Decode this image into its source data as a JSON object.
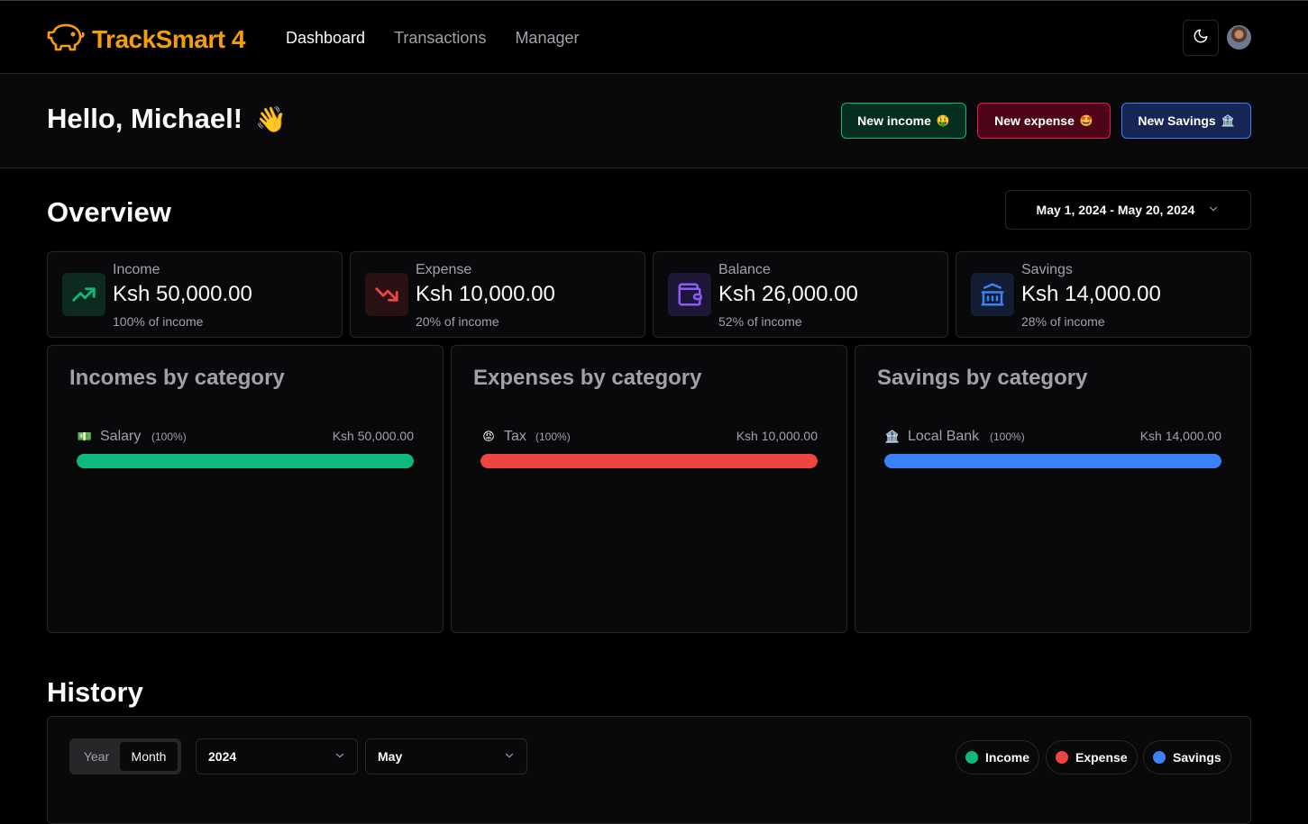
{
  "app": {
    "name": "TrackSmart 4",
    "brand_color": "#f59e0b"
  },
  "nav": {
    "items": [
      {
        "label": "Dashboard",
        "active": true
      },
      {
        "label": "Transactions",
        "active": false
      },
      {
        "label": "Manager",
        "active": false
      }
    ]
  },
  "greeting": {
    "text": "Hello, Michael!",
    "emoji": "👋"
  },
  "actions": {
    "income": {
      "label": "New income",
      "emoji": "🤑",
      "color": "#10b981"
    },
    "expense": {
      "label": "New expense",
      "emoji": "🤩",
      "color": "#e11d48"
    },
    "savings": {
      "label": "New Savings",
      "emoji": "🏦",
      "color": "#3b82f6"
    }
  },
  "overview": {
    "title": "Overview",
    "date_range": "May 1, 2024 - May 20, 2024",
    "stats": [
      {
        "label": "Income",
        "value": "Ksh 50,000.00",
        "sub": "100% of income",
        "icon": "trending-up-icon",
        "color": "#10b981"
      },
      {
        "label": "Expense",
        "value": "Ksh 10,000.00",
        "sub": "20% of income",
        "icon": "trending-down-icon",
        "color": "#ef4444"
      },
      {
        "label": "Balance",
        "value": "Ksh 26,000.00",
        "sub": "52% of income",
        "icon": "wallet-icon",
        "color": "#8b5cf6"
      },
      {
        "label": "Savings",
        "value": "Ksh 14,000.00",
        "sub": "28% of income",
        "icon": "bank-icon",
        "color": "#3b82f6"
      }
    ]
  },
  "categories": [
    {
      "title": "Incomes by category",
      "item": {
        "emoji": "💵",
        "name": "Salary",
        "percent": "(100%)",
        "amount": "Ksh 50,000.00",
        "fill": 1.0
      },
      "color": "#10b981"
    },
    {
      "title": "Expenses by category",
      "item": {
        "emoji": "😡",
        "name": "Tax",
        "percent": "(100%)",
        "amount": "Ksh 10,000.00",
        "fill": 1.0
      },
      "color": "#ef4444"
    },
    {
      "title": "Savings by category",
      "item": {
        "emoji": "🏦",
        "name": "Local Bank",
        "percent": "(100%)",
        "amount": "Ksh 14,000.00",
        "fill": 1.0
      },
      "color": "#3b82f6"
    }
  ],
  "history": {
    "title": "History",
    "tabs": {
      "year": "Year",
      "month": "Month",
      "selected": "Month"
    },
    "year_select": "2024",
    "month_select": "May",
    "legend": [
      {
        "label": "Income",
        "color": "#10b981"
      },
      {
        "label": "Expense",
        "color": "#ef4444"
      },
      {
        "label": "Savings",
        "color": "#3b82f6"
      }
    ]
  }
}
